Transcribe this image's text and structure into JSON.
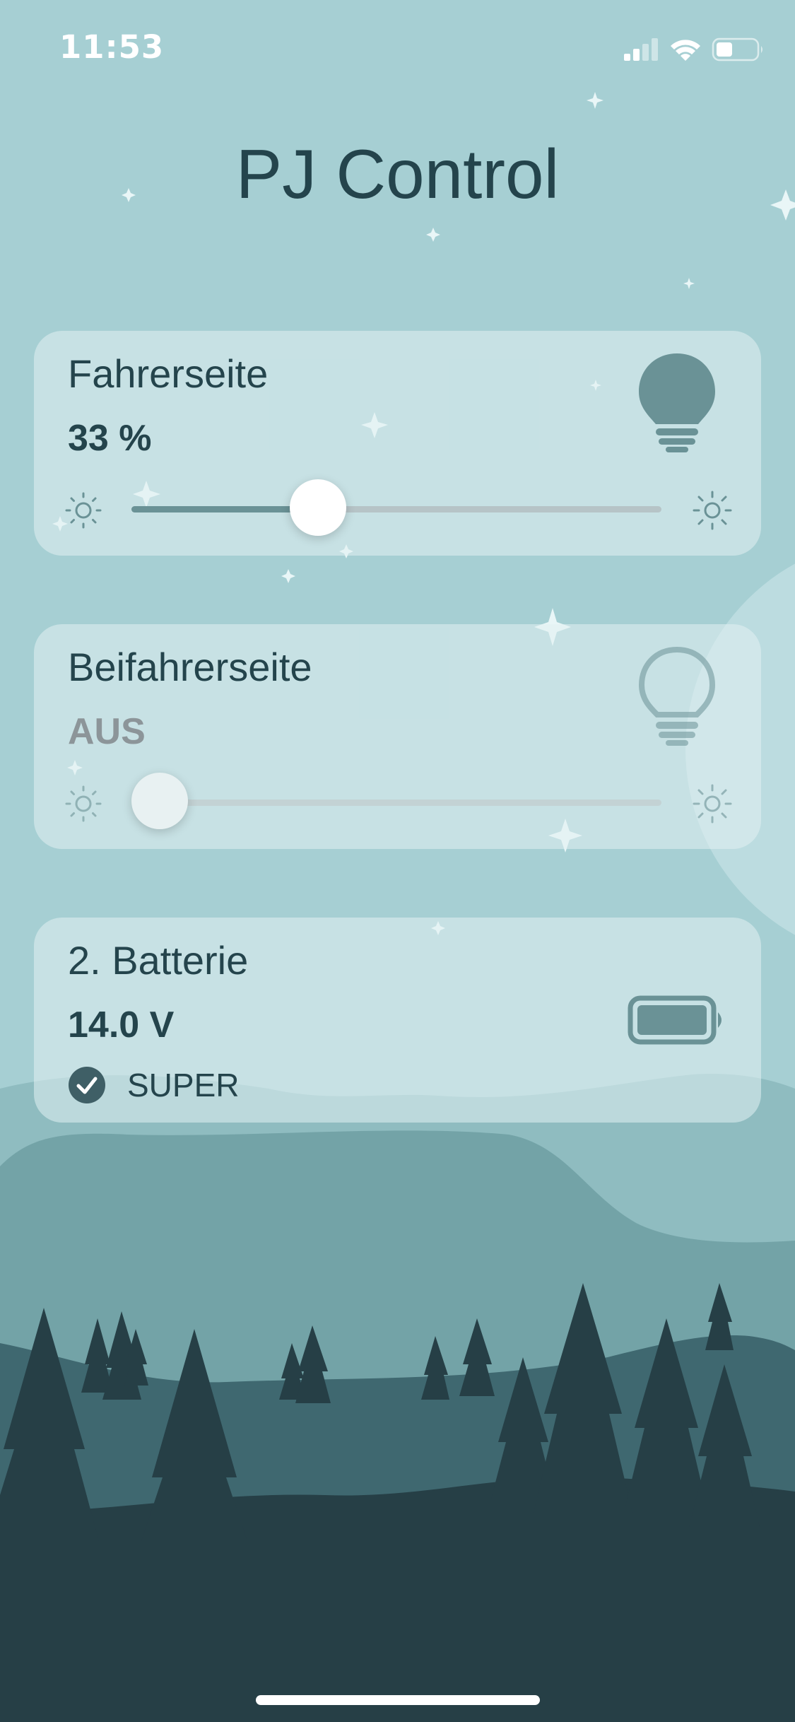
{
  "status_bar": {
    "time": "11:53",
    "icons": [
      "cellular-signal-icon",
      "wifi-icon",
      "battery-icon"
    ]
  },
  "page": {
    "title": "PJ Control"
  },
  "lights": [
    {
      "name": "Fahrerseite",
      "value_text": "33 %",
      "level": 0.33,
      "state": "on",
      "icon": "bulb-filled-icon"
    },
    {
      "name": "Beifahrerseite",
      "value_text": "AUS",
      "level": 0,
      "state": "off",
      "icon": "bulb-outline-icon"
    }
  ],
  "battery": {
    "title": "2. Batterie",
    "voltage": "14.0 V",
    "status_label": "SUPER",
    "status_icon": "check-circle-icon",
    "icon": "battery-full-icon"
  },
  "colors": {
    "sky": "#a6cfd3",
    "text_dark": "#24444c",
    "accent": "#6a9296",
    "forest_dark": "#263f46",
    "off_text": "#8c9599"
  }
}
